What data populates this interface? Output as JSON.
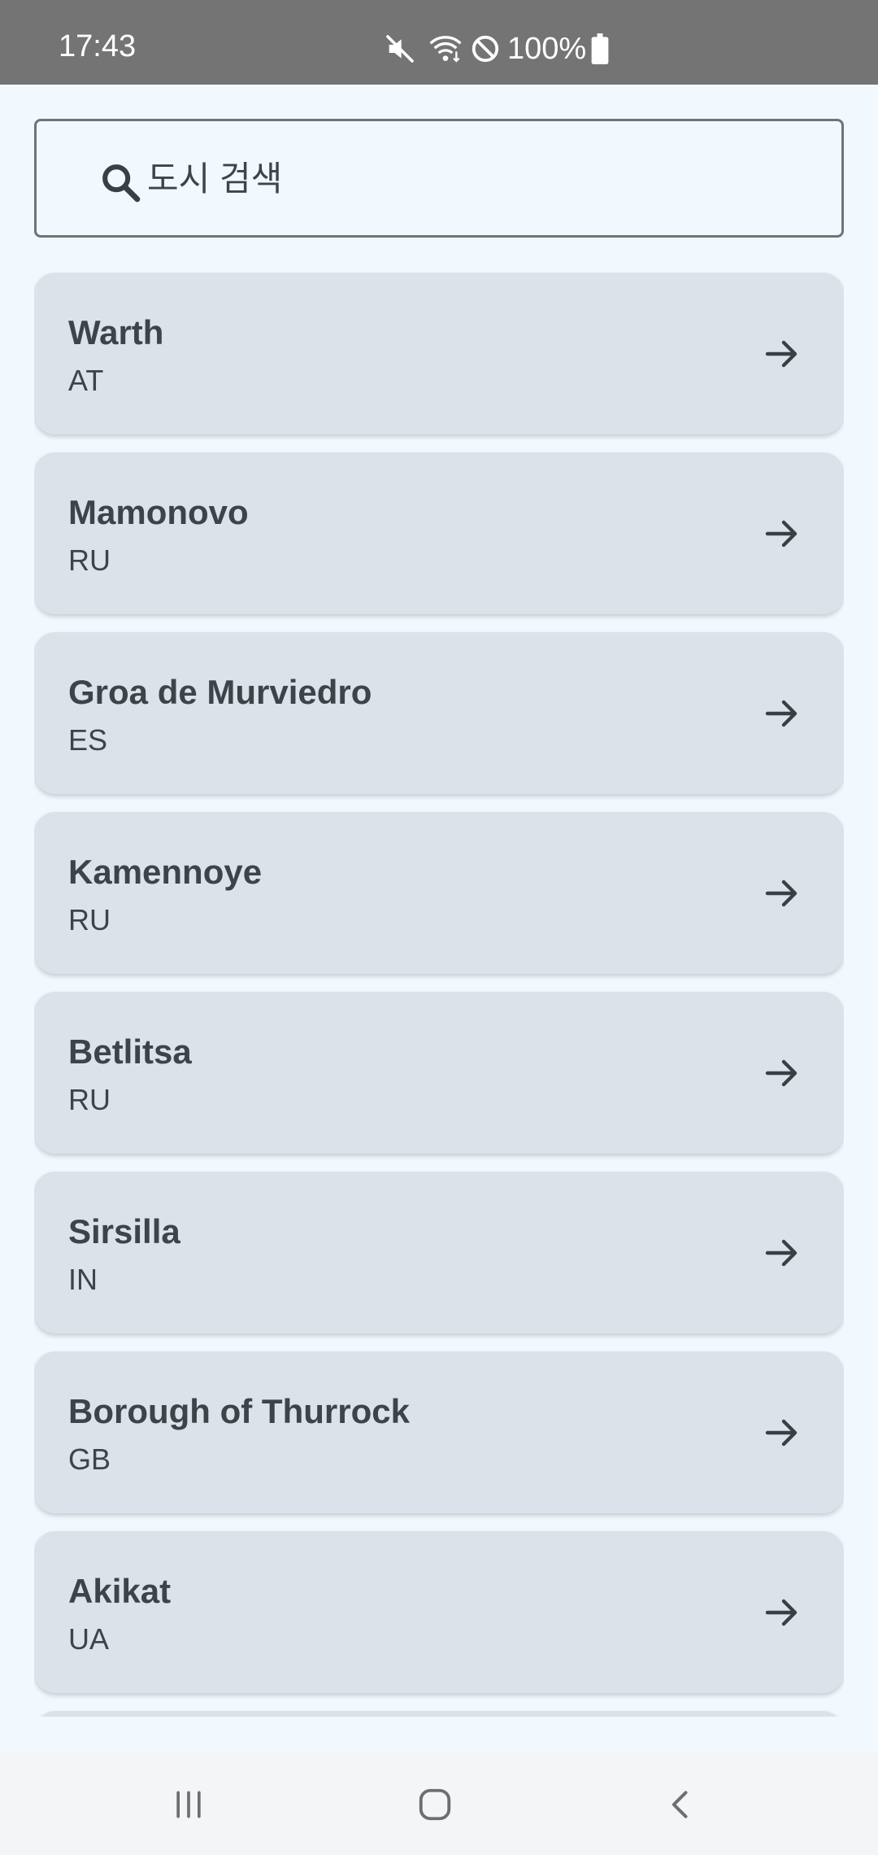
{
  "status_bar": {
    "time": "17:43",
    "battery_text": "100%",
    "icons": [
      "mute-icon",
      "wifi-icon",
      "do-not-disturb-icon",
      "battery-icon"
    ]
  },
  "search": {
    "placeholder": "도시 검색",
    "value": "",
    "icon": "search-icon"
  },
  "cities": [
    {
      "name": "Warth",
      "country": "AT"
    },
    {
      "name": "Mamonovo",
      "country": "RU"
    },
    {
      "name": "Groa de Murviedro",
      "country": "ES"
    },
    {
      "name": "Kamennoye",
      "country": "RU"
    },
    {
      "name": "Betlitsa",
      "country": "RU"
    },
    {
      "name": "Sirsilla",
      "country": "IN"
    },
    {
      "name": "Borough of Thurrock",
      "country": "GB"
    },
    {
      "name": "Akikat",
      "country": "UA"
    }
  ],
  "card_icon": "arrow-right-icon",
  "nav_bar": {
    "buttons": [
      "recent-apps-icon",
      "home-icon",
      "back-icon"
    ]
  },
  "colors": {
    "background": "#f2f9fe",
    "card": "#dce2e9",
    "text": "#3e4349",
    "status_bar": "#747474"
  }
}
